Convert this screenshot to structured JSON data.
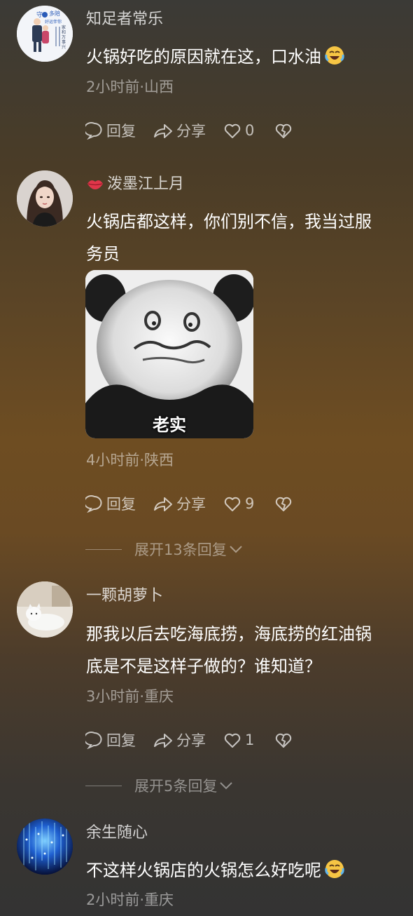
{
  "comments": [
    {
      "username": "知足者常乐",
      "text": "火锅好吃的原因就在这，口水油",
      "emoji": "laughing-tears-emoji",
      "meta": "2小时前·山西",
      "actions": {
        "reply": "回复",
        "share": "分享",
        "likes": "0"
      },
      "avatar_text": {
        "top": "守",
        "top2": "多陪",
        "mid": "好运伴你",
        "side": "家和万事兴"
      }
    },
    {
      "username": "泼墨江上月",
      "username_icon": "lips-icon",
      "text": "火锅店都这样，你们别不信，我当过服务员",
      "image_caption": "老实",
      "meta": "4小时前·陕西",
      "actions": {
        "reply": "回复",
        "share": "分享",
        "likes": "9"
      },
      "expand": "展开13条回复"
    },
    {
      "username": "一颗胡萝卜",
      "text": "那我以后去吃海底捞，海底捞的红油锅底是不是这样子做的？谁知道？",
      "meta": "3小时前·重庆",
      "actions": {
        "reply": "回复",
        "share": "分享",
        "likes": "1"
      },
      "expand": "展开5条回复"
    },
    {
      "username": "余生随心",
      "text": "不这样火锅店的火锅怎么好吃呢",
      "emoji": "laughing-tears-emoji",
      "meta": "2小时前·重庆"
    }
  ],
  "colors": {
    "accent_lips": "#e0364a",
    "emoji_yellow": "#f6c544"
  }
}
